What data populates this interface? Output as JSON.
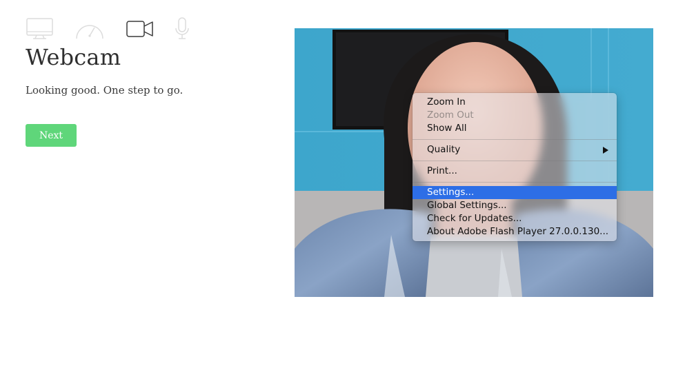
{
  "steps": {
    "icons": [
      "monitor-icon",
      "speedometer-icon",
      "video-camera-icon",
      "microphone-icon"
    ],
    "active": "video-camera-icon"
  },
  "header": {
    "title": "Webcam",
    "subtitle": "Looking good. One step to go."
  },
  "actions": {
    "next_label": "Next",
    "next_color": "#5fd67a"
  },
  "context_menu": {
    "zoom_in": "Zoom In",
    "zoom_out": "Zoom Out",
    "show_all": "Show All",
    "quality": "Quality",
    "print": "Print...",
    "settings": "Settings...",
    "global_settings": "Global Settings...",
    "check_updates": "Check for Updates...",
    "about": "About Adobe Flash Player 27.0.0.130...",
    "highlight_color": "#2d6ee6"
  }
}
